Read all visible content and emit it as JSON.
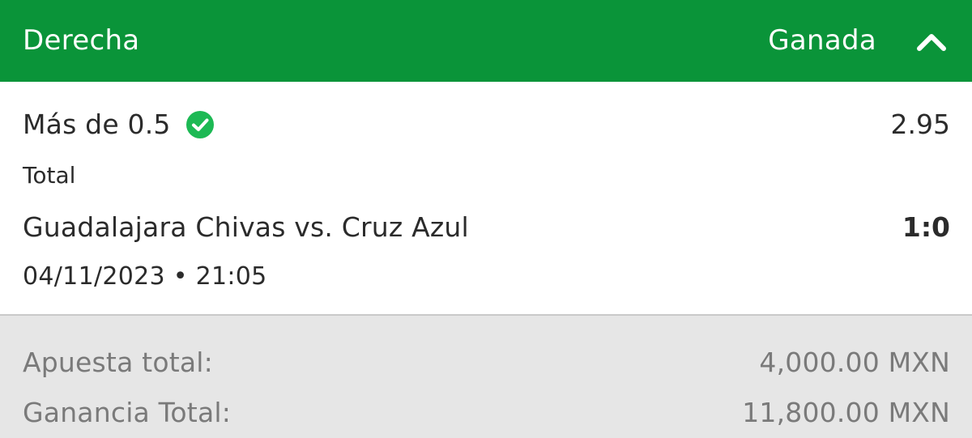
{
  "header": {
    "title": "Derecha",
    "status": "Ganada",
    "collapse_icon": "chevron-up-icon",
    "background_color": "#0a9439"
  },
  "selection": {
    "label": "Más de 0.5",
    "status_icon": "check-circle-icon",
    "status_icon_color": "#1db954",
    "odds": "2.95"
  },
  "market": "Total",
  "event": {
    "match": "Guadalajara Chivas vs. Cruz Azul",
    "score": "1:0",
    "datetime": "04/11/2023 • 21:05"
  },
  "summary": {
    "stake_label": "Apuesta total:",
    "stake_value": "4,000.00 MXN",
    "winnings_label": "Ganancia Total:",
    "winnings_value": "11,800.00 MXN"
  }
}
